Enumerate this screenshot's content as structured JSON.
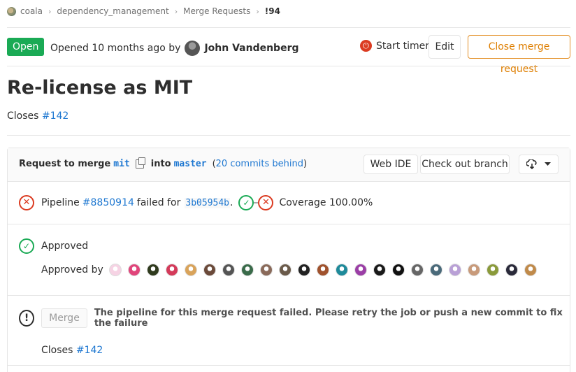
{
  "breadcrumb": {
    "items": [
      "coala",
      "dependency_management",
      "Merge Requests"
    ],
    "current": "!94",
    "separator": "›"
  },
  "header": {
    "status": "Open",
    "opened_prefix": "Opened 10 months ago by",
    "author": "John Vandenberg",
    "timer_label": "Start timer",
    "edit_label": "Edit",
    "close_label": "Close merge request"
  },
  "issue": {
    "title": "Re-license as MIT",
    "closes_prefix": "Closes",
    "closes_ref": "#142"
  },
  "widget": {
    "request_prefix": "Request to merge",
    "source_branch": "mit",
    "into": "into",
    "target_branch": "master",
    "behind_open": "(",
    "behind_link": "20 commits behind",
    "behind_close": ")",
    "web_ide_label": "Web IDE",
    "checkout_label": "Check out branch",
    "pipeline": {
      "prefix": "Pipeline",
      "id": "#8850914",
      "failed_for": "failed for",
      "sha": "3b05954b",
      "dot": ".",
      "coverage": "Coverage 100.00%"
    },
    "approval": {
      "status": "Approved",
      "approved_by": "Approved by",
      "avatar_colors": [
        "#f6d3e4",
        "#e0447a",
        "#2f3a1d",
        "#d43a5a",
        "#d9a35a",
        "#6b4a3a",
        "#555555",
        "#3a6b4a",
        "#8a6a5a",
        "#6a5a4a",
        "#222222",
        "#a0522d",
        "#1e8a9a",
        "#9b3ea6",
        "#1a1a1a",
        "#111111",
        "#666666",
        "#4a6a7a",
        "#b9a0d6",
        "#c89a7a",
        "#8a9a3a",
        "#2a2a3a",
        "#c08a4a"
      ]
    },
    "merge": {
      "button_label": "Merge",
      "message": "The pipeline for this merge request failed. Please retry the job or push a new commit to fix the failure",
      "closes_prefix": "Closes",
      "closes_ref": "#142"
    }
  }
}
